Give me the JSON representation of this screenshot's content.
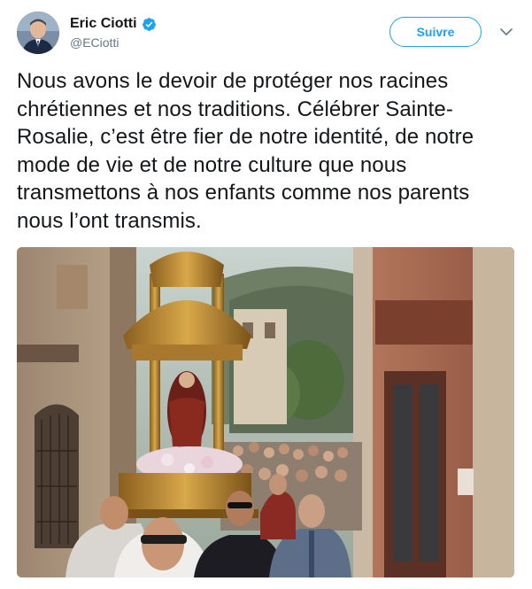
{
  "author": {
    "display_name": "Eric Ciotti",
    "handle": "@ECiotti",
    "verified": true,
    "verified_icon": "verified-badge-icon",
    "avatar_icon": "avatar-portrait"
  },
  "actions": {
    "follow_label": "Suivre",
    "more_icon": "chevron-down-icon"
  },
  "tweet": {
    "text": "Nous avons le devoir de protéger nos racines chrétiennes et nos traditions. Célébrer Sainte-Rosalie, c’est être fier de notre identité, de notre mode de vie et de notre culture que nous transmettons à nos enfants comme nos parents nous l’ont transmis."
  },
  "media": {
    "type": "photo",
    "icon": "procession-photo"
  },
  "colors": {
    "accent": "#1da1f2",
    "text": "#14171a",
    "secondary_text": "#657786"
  }
}
